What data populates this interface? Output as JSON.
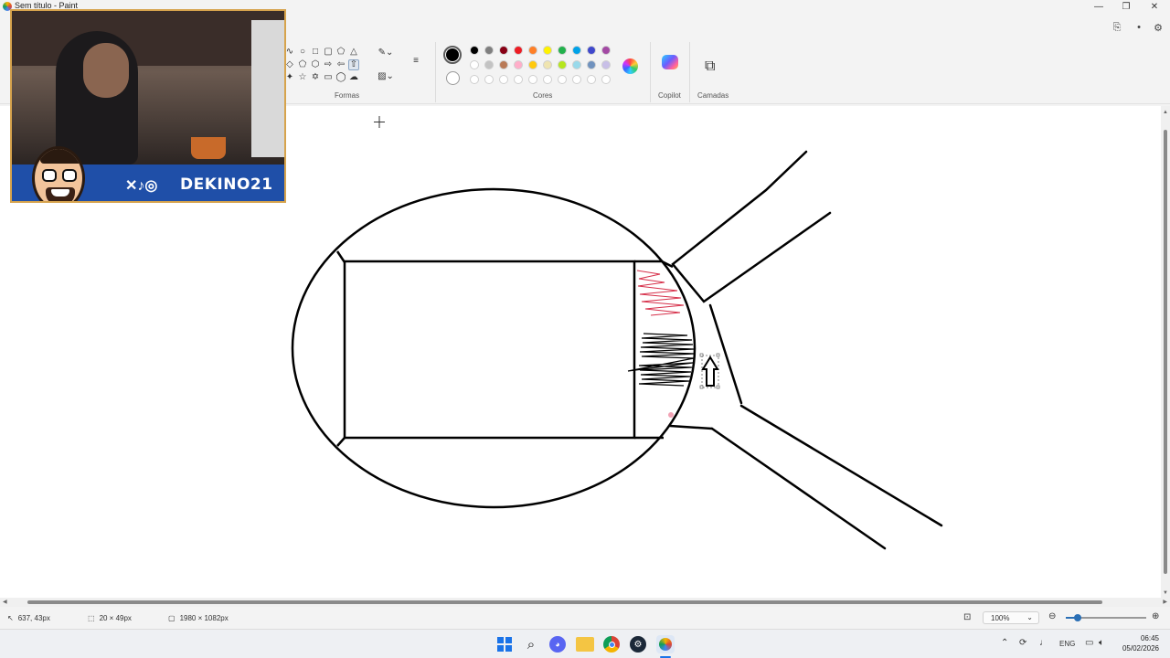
{
  "window": {
    "title": "Sem título - Paint",
    "minimize_icon": "minimize-icon",
    "maximize_icon": "restore-icon",
    "close_icon": "close-icon"
  },
  "ribbon": {
    "groups": {
      "shapes": "Formas",
      "colors": "Cores",
      "copilot": "Copilot",
      "layers": "Camadas"
    },
    "active_shape": "up-arrow-shape",
    "primary_color": "#000000",
    "secondary_color": "#ffffff",
    "palette_row1": [
      "#000000",
      "#7f7f7f",
      "#880015",
      "#ed1c24",
      "#ff7f27",
      "#fff200",
      "#22b14c",
      "#00a2e8",
      "#3f48cc",
      "#a349a4"
    ],
    "palette_row2": [
      "#ffffff",
      "#c3c3c3",
      "#b97a57",
      "#ffaec9",
      "#ffc90e",
      "#efe4b0",
      "#b5e61d",
      "#99d9ea",
      "#7092be",
      "#c8bfe7"
    ],
    "palette_row3_count": 10
  },
  "webcam": {
    "social_handle": "DEKINO21",
    "social_icons": [
      "x-logo",
      "tiktok-logo",
      "instagram-logo"
    ]
  },
  "status": {
    "cursor_position": "637, 43px",
    "selection_size": "20 × 49px",
    "canvas_size": "1980 × 1082px",
    "zoom": "100%",
    "zoom_level": 0.15
  },
  "taskbar": {
    "apps": [
      "windows-start-icon",
      "search-icon",
      "discord-icon",
      "file-explorer-icon",
      "chrome-icon",
      "steam-icon",
      "paint-icon"
    ],
    "language": "ENG",
    "time": "06:45",
    "date": "05/02/2026"
  }
}
